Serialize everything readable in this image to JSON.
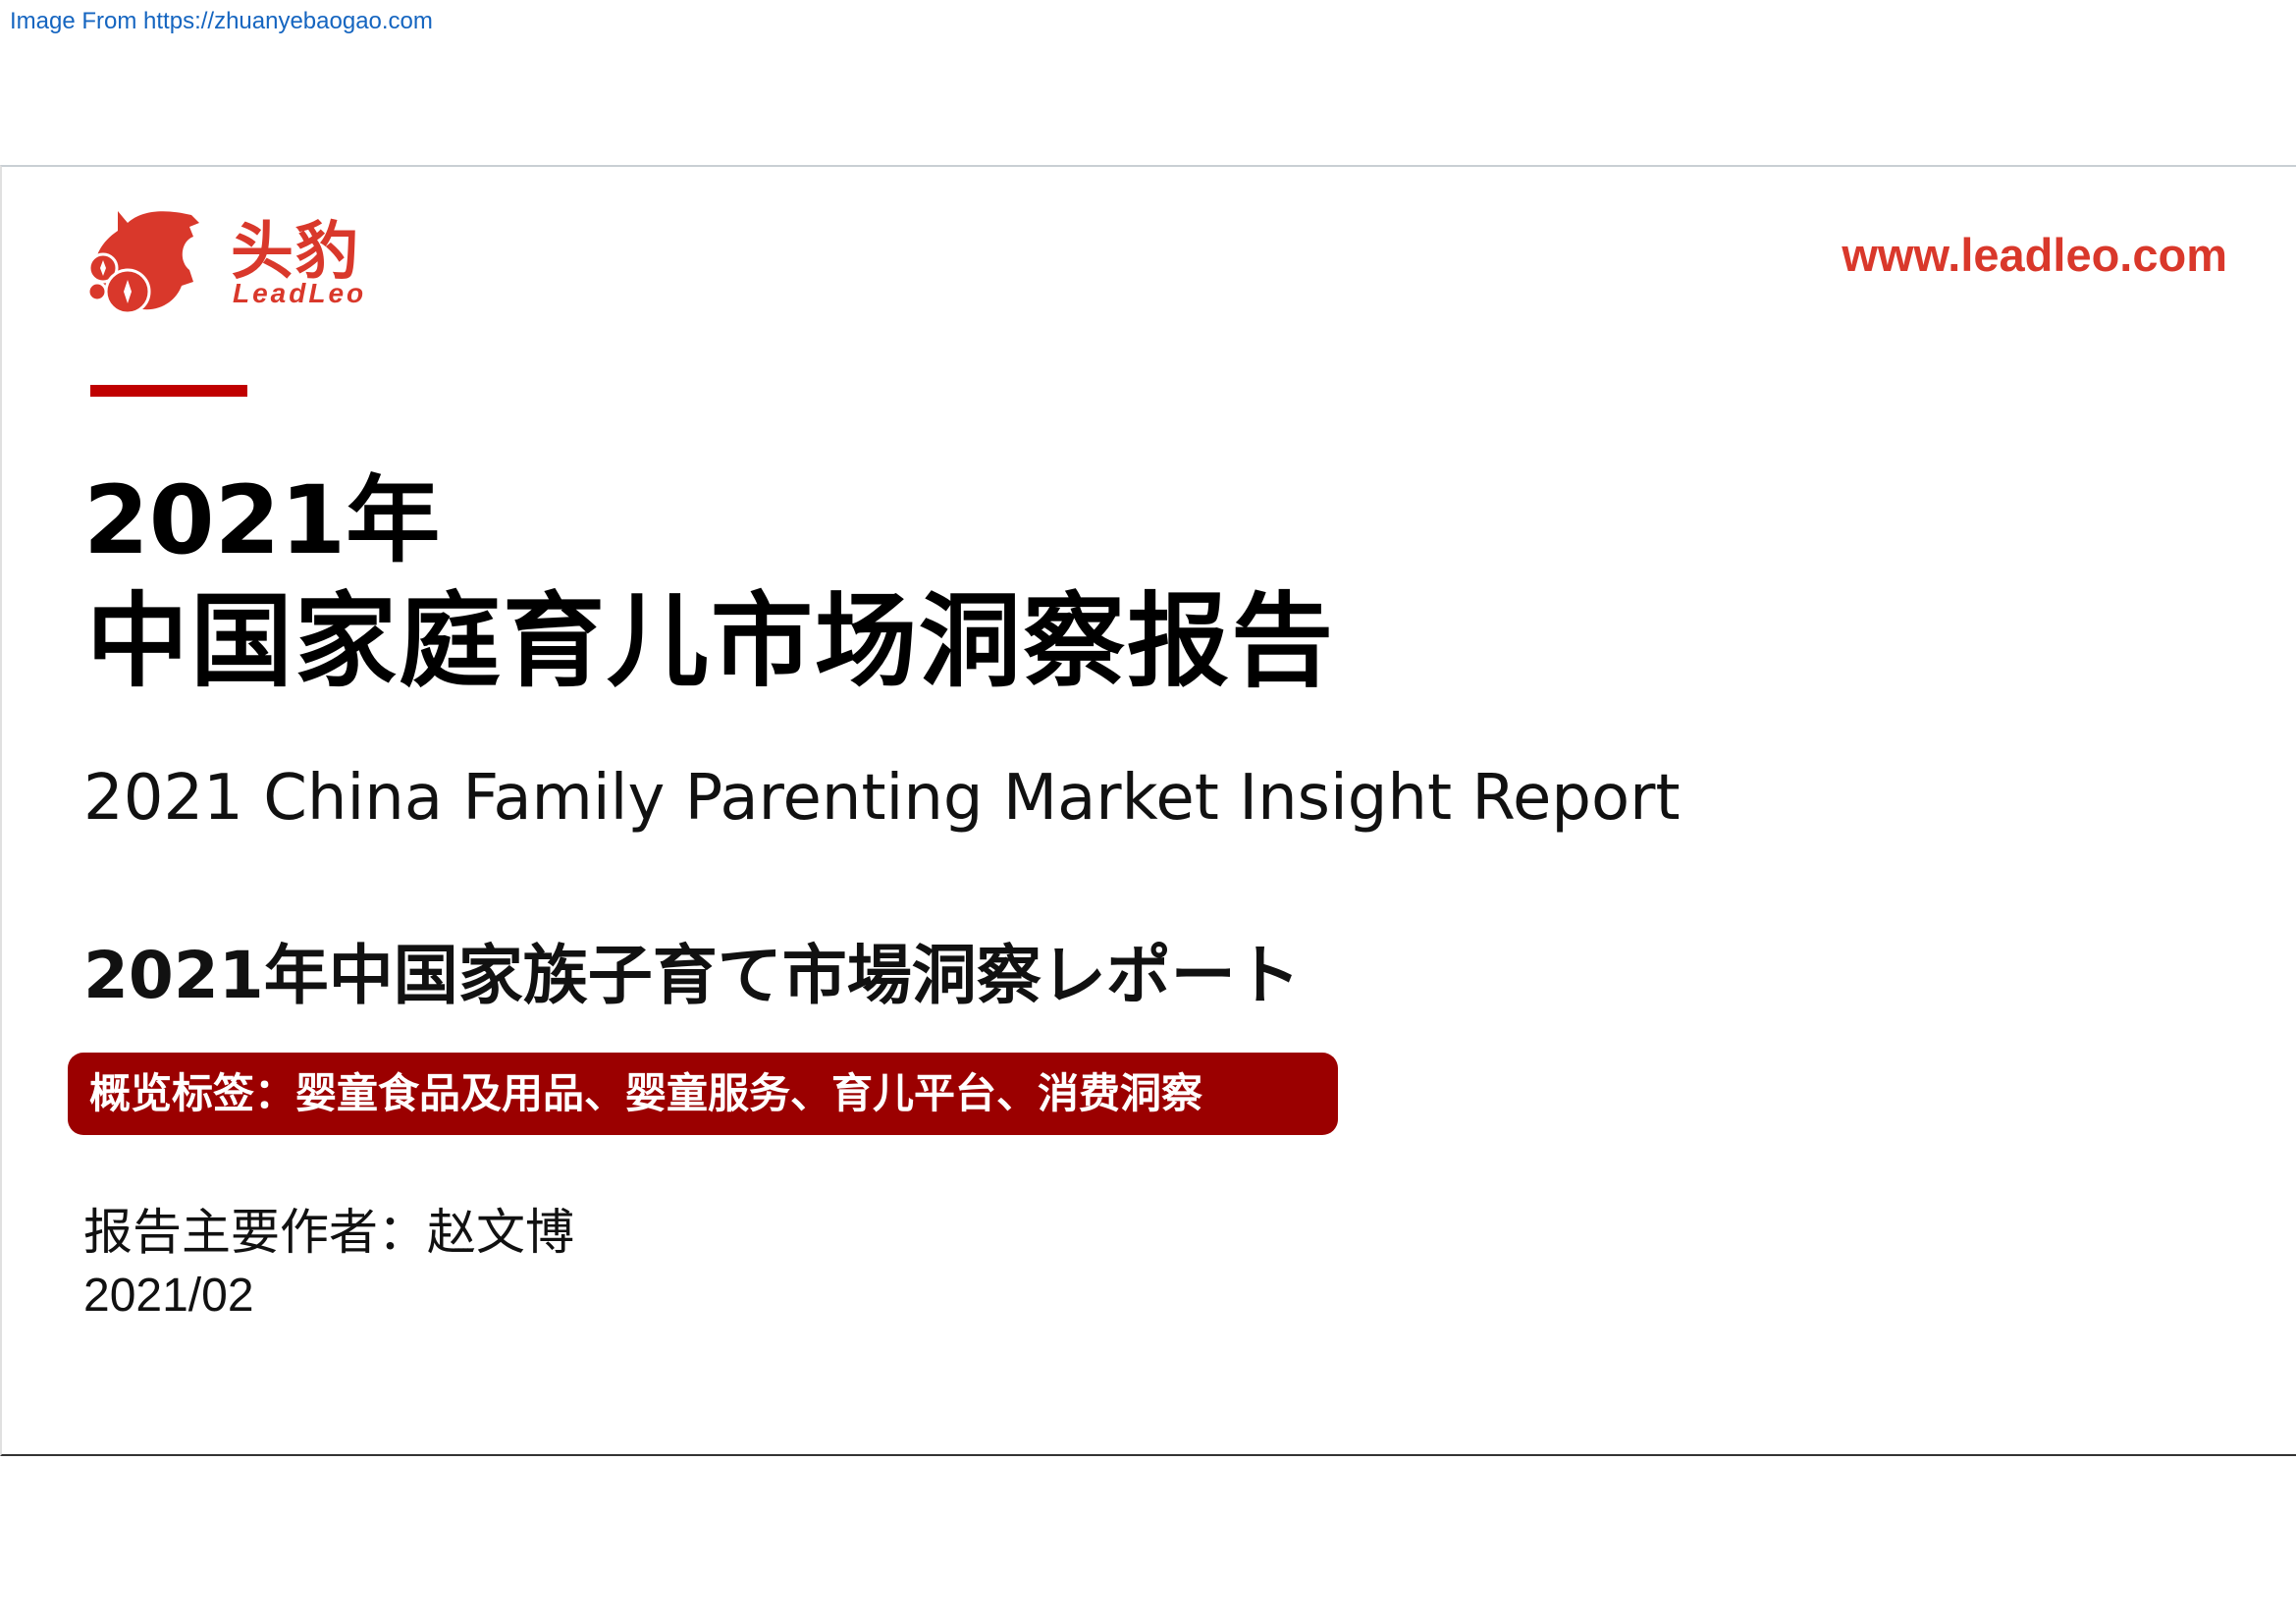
{
  "watermark": "Image From https://zhuanyebaogao.com",
  "logo": {
    "cn": "头豹",
    "en": "LeadLeo"
  },
  "header": {
    "url": "www.leadleo.com"
  },
  "colors": {
    "brand_red": "#d9382b",
    "tag_bg": "#9b0000",
    "accent_bar": "#c00000"
  },
  "title": {
    "year": "2021年",
    "cn": "中国家庭育儿市场洞察报告",
    "en": "2021 China Family Parenting Market Insight Report",
    "jp": "2021年中国家族子育て市場洞察レポート"
  },
  "tag": "概览标签：婴童食品及用品、婴童服务、育儿平台、消费洞察",
  "author": "报告主要作者：赵文博",
  "date": "2021/02"
}
